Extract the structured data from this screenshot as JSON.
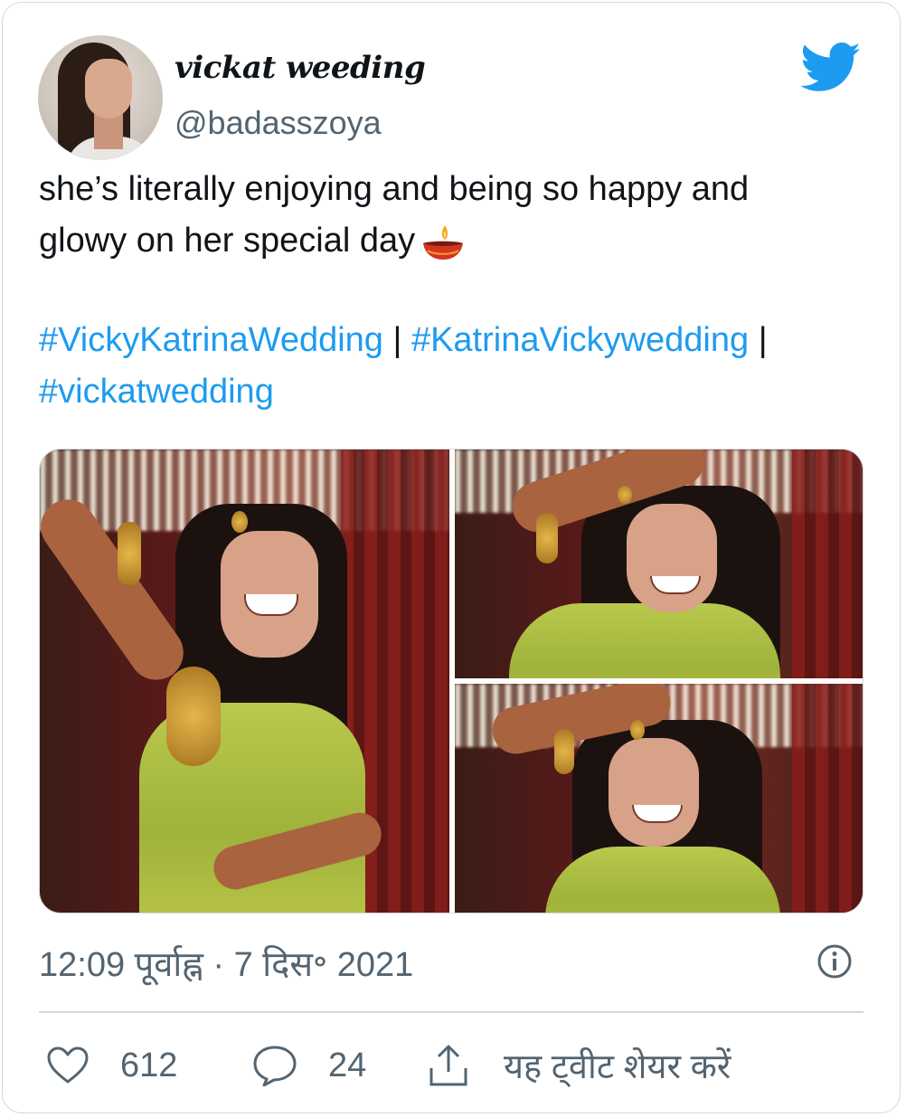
{
  "tweet": {
    "author_name": "vickat weeding",
    "author_handle": "@badasszoya",
    "text_lines": [
      "she’s literally enjoying and being so happy and",
      "glowy on her special day"
    ],
    "emoji": "diya-lamp",
    "hashtags": {
      "tag1": "#VickyKatrinaWedding",
      "sep1": " | ",
      "tag2": "#KatrinaVickywedding",
      "sep2": " |",
      "tag3": "#vickatwedding"
    },
    "timestamp": "12:09 पूर्वाह्न · 7 दिस॰ 2021"
  },
  "media": {
    "photo_count": 3,
    "photos": [
      "photo-1",
      "photo-2",
      "photo-3"
    ]
  },
  "actions": {
    "like_count": "612",
    "reply_count": "24",
    "share_label": "यह ट्वीट शेयर करें"
  },
  "icons": {
    "brand": "twitter-bird-icon",
    "info": "info-icon",
    "like": "heart-icon",
    "reply": "speech-bubble-icon",
    "share": "share-icon"
  },
  "colors": {
    "accent": "#1d9bf0",
    "text": "#0f1419",
    "muted": "#536471",
    "border": "#cfd9de"
  }
}
